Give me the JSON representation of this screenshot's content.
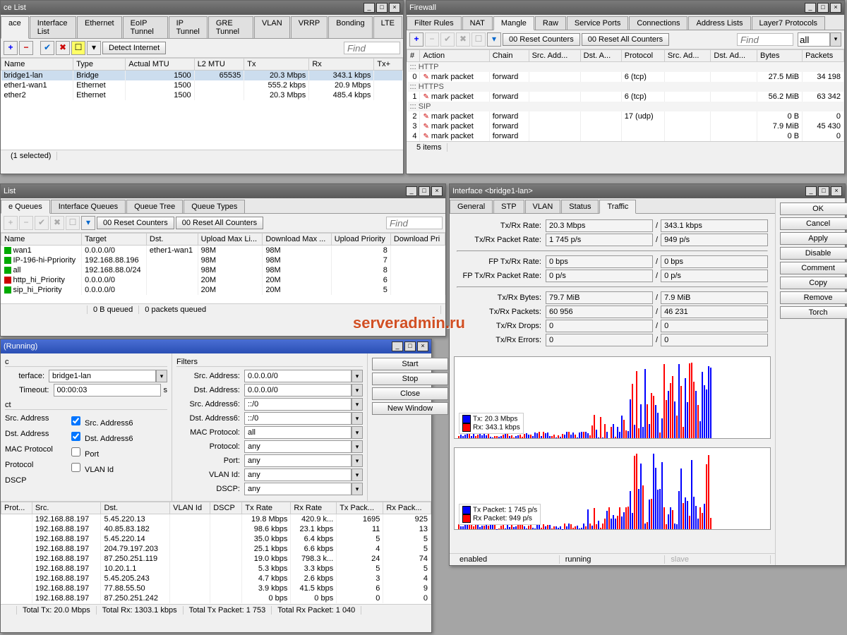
{
  "watermark": "serveradmin.ru",
  "interface_list": {
    "title": "ce List",
    "tabs": [
      "ace",
      "Interface List",
      "Ethernet",
      "EoIP Tunnel",
      "IP Tunnel",
      "GRE Tunnel",
      "VLAN",
      "VRRP",
      "Bonding",
      "LTE"
    ],
    "active_tab": 0,
    "detect_btn": "Detect Internet",
    "find": "Find",
    "cols": [
      "Name",
      "Type",
      "Actual MTU",
      "L2 MTU",
      "Tx",
      "Rx",
      "Tx+"
    ],
    "rows": [
      {
        "name": "bridge1-lan",
        "type": "Bridge",
        "mtu": "1500",
        "l2": "65535",
        "tx": "20.3 Mbps",
        "rx": "343.1 kbps",
        "sel": true
      },
      {
        "name": "ether1-wan1",
        "type": "Ethernet",
        "mtu": "1500",
        "l2": "",
        "tx": "555.2 kbps",
        "rx": "20.9 Mbps"
      },
      {
        "name": "ether2",
        "type": "Ethernet",
        "mtu": "1500",
        "l2": "",
        "tx": "20.3 Mbps",
        "rx": "485.4 kbps"
      }
    ],
    "status": "(1 selected)"
  },
  "firewall": {
    "title": "Firewall",
    "tabs": [
      "Filter Rules",
      "NAT",
      "Mangle",
      "Raw",
      "Service Ports",
      "Connections",
      "Address Lists",
      "Layer7 Protocols"
    ],
    "active_tab": 2,
    "reset": "00 Reset Counters",
    "reset_all": "00 Reset All Counters",
    "find": "Find",
    "all": "all",
    "cols": [
      "#",
      "Action",
      "Chain",
      "Src. Add...",
      "Dst. A...",
      "Protocol",
      "Src. Ad...",
      "Dst. Ad...",
      "Bytes",
      "Packets"
    ],
    "groups": [
      {
        "label": "::: HTTP",
        "rows": [
          {
            "n": "0",
            "act": "mark packet",
            "chain": "forward",
            "proto": "6 (tcp)",
            "bytes": "27.5 MiB",
            "pk": "34 198"
          }
        ]
      },
      {
        "label": "::: HTTPS",
        "rows": [
          {
            "n": "1",
            "act": "mark packet",
            "chain": "forward",
            "proto": "6 (tcp)",
            "bytes": "56.2 MiB",
            "pk": "63 342"
          }
        ]
      },
      {
        "label": "::: SIP",
        "rows": [
          {
            "n": "2",
            "act": "mark packet",
            "chain": "forward",
            "proto": "17 (udp)",
            "bytes": "0 B",
            "pk": "0"
          },
          {
            "n": "3",
            "act": "mark packet",
            "chain": "forward",
            "proto": "",
            "bytes": "7.9 MiB",
            "pk": "45 430"
          },
          {
            "n": "4",
            "act": "mark packet",
            "chain": "forward",
            "proto": "",
            "bytes": "0 B",
            "pk": "0"
          }
        ]
      }
    ],
    "status": "5 items"
  },
  "queue": {
    "title": "List",
    "tabs": [
      "e Queues",
      "Interface Queues",
      "Queue Tree",
      "Queue Types"
    ],
    "active_tab": 0,
    "reset": "00 Reset Counters",
    "reset_all": "00 Reset All Counters",
    "find": "Find",
    "cols": [
      "Name",
      "Target",
      "Dst.",
      "Upload Max Li...",
      "Download Max ...",
      "Upload Priority",
      "Download Pri"
    ],
    "rows": [
      {
        "ic": "g",
        "name": "wan1",
        "target": "0.0.0.0/0",
        "dst": "ether1-wan1",
        "ul": "98M",
        "dl": "98M",
        "up": "8"
      },
      {
        "ic": "g",
        "name": "IP-196-hi-Ppriority",
        "target": "192.168.88.196",
        "dst": "",
        "ul": "98M",
        "dl": "98M",
        "up": "7"
      },
      {
        "ic": "g",
        "name": "all",
        "target": "192.168.88.0/24",
        "dst": "",
        "ul": "98M",
        "dl": "98M",
        "up": "8"
      },
      {
        "ic": "r",
        "name": "http_hi_Priority",
        "target": "0.0.0.0/0",
        "dst": "",
        "ul": "20M",
        "dl": "20M",
        "up": "6"
      },
      {
        "ic": "g",
        "name": "sip_hi_Priority",
        "target": "0.0.0.0/0",
        "dst": "",
        "ul": "20M",
        "dl": "20M",
        "up": "5"
      }
    ],
    "status_b": "0 B queued",
    "status_p": "0 packets queued"
  },
  "torch": {
    "title": "(Running)",
    "basic": "c",
    "filters": "Filters",
    "interface_lbl": "terface:",
    "interface": "bridge1-lan",
    "timeout_lbl": "Timeout:",
    "timeout": "00:00:03",
    "s": "s",
    "section_ct": "ct",
    "opts": [
      "Src. Address",
      "Dst. Address",
      "MAC Protocol",
      "Protocol",
      "DSCP"
    ],
    "chk1": "Src. Address6",
    "chk2": "Dst. Address6",
    "chk3": "Port",
    "chk4": "VLAN Id",
    "f_src": "Src. Address:",
    "f_src_v": "0.0.0.0/0",
    "f_dst": "Dst. Address:",
    "f_dst_v": "0.0.0.0/0",
    "f_src6": "Src. Address6:",
    "f_src6_v": "::/0",
    "f_dst6": "Dst. Address6:",
    "f_dst6_v": "::/0",
    "f_mac": "MAC Protocol:",
    "f_mac_v": "all",
    "f_proto": "Protocol:",
    "f_proto_v": "any",
    "f_port": "Port:",
    "f_port_v": "any",
    "f_vlan": "VLAN Id:",
    "f_vlan_v": "any",
    "f_dscp": "DSCP:",
    "f_dscp_v": "any",
    "btns": [
      "Start",
      "Stop",
      "Close",
      "New Window"
    ],
    "tcols": [
      "Prot...",
      "Src.",
      "Dst.",
      "VLAN Id",
      "DSCP",
      "Tx Rate",
      "Rx Rate",
      "Tx Pack...",
      "Rx Pack..."
    ],
    "trows": [
      {
        "src": "192.168.88.197",
        "dst": "5.45.220.13",
        "tx": "19.8 Mbps",
        "rx": "420.9 k...",
        "txp": "1695",
        "rxp": "925"
      },
      {
        "src": "192.168.88.197",
        "dst": "40.85.83.182",
        "tx": "98.6 kbps",
        "rx": "23.1 kbps",
        "txp": "11",
        "rxp": "13"
      },
      {
        "src": "192.168.88.197",
        "dst": "5.45.220.14",
        "tx": "35.0 kbps",
        "rx": "6.4 kbps",
        "txp": "5",
        "rxp": "5"
      },
      {
        "src": "192.168.88.197",
        "dst": "204.79.197.203",
        "tx": "25.1 kbps",
        "rx": "6.6 kbps",
        "txp": "4",
        "rxp": "5"
      },
      {
        "src": "192.168.88.197",
        "dst": "87.250.251.119",
        "tx": "19.0 kbps",
        "rx": "798.3 k...",
        "txp": "24",
        "rxp": "74"
      },
      {
        "src": "192.168.88.197",
        "dst": "10.20.1.1",
        "tx": "5.3 kbps",
        "rx": "3.3 kbps",
        "txp": "5",
        "rxp": "5"
      },
      {
        "src": "192.168.88.197",
        "dst": "5.45.205.243",
        "tx": "4.7 kbps",
        "rx": "2.6 kbps",
        "txp": "3",
        "rxp": "4"
      },
      {
        "src": "192.168.88.197",
        "dst": "77.88.55.50",
        "tx": "3.9 kbps",
        "rx": "41.5 kbps",
        "txp": "6",
        "rxp": "9"
      },
      {
        "src": "192.168.88.197",
        "dst": "87.250.251.242",
        "tx": "0 bps",
        "rx": "0 bps",
        "txp": "0",
        "rxp": "0"
      }
    ],
    "totals": {
      "tx": "Total Tx: 20.0 Mbps",
      "rx": "Total Rx: 1303.1 kbps",
      "txp": "Total Tx Packet: 1 753",
      "rxp": "Total Rx Packet: 1 040"
    }
  },
  "iface_detail": {
    "title": "Interface <bridge1-lan>",
    "tabs": [
      "General",
      "STP",
      "VLAN",
      "Status",
      "Traffic"
    ],
    "active_tab": 4,
    "rows": [
      {
        "lbl": "Tx/Rx Rate:",
        "a": "20.3 Mbps",
        "b": "343.1 kbps"
      },
      {
        "lbl": "Tx/Rx Packet Rate:",
        "a": "1 745 p/s",
        "b": "949 p/s"
      },
      {
        "lbl": "FP Tx/Rx Rate:",
        "a": "0 bps",
        "b": "0 bps"
      },
      {
        "lbl": "FP Tx/Rx Packet Rate:",
        "a": "0 p/s",
        "b": "0 p/s"
      },
      {
        "lbl": "Tx/Rx Bytes:",
        "a": "79.7 MiB",
        "b": "7.9 MiB"
      },
      {
        "lbl": "Tx/Rx Packets:",
        "a": "60 956",
        "b": "46 231"
      },
      {
        "lbl": "Tx/Rx Drops:",
        "a": "0",
        "b": "0"
      },
      {
        "lbl": "Tx/Rx Errors:",
        "a": "0",
        "b": "0"
      }
    ],
    "legend1": {
      "tx": "Tx: 20.3 Mbps",
      "rx": "Rx: 343.1 kbps"
    },
    "legend2": {
      "tx": "Tx Packet: 1 745 p/s",
      "rx": "Rx Packet: 949 p/s"
    },
    "btns": [
      "OK",
      "Cancel",
      "Apply",
      "Disable",
      "Comment",
      "Copy",
      "Remove",
      "Torch"
    ],
    "status": {
      "en": "enabled",
      "run": "running",
      "slave": "slave"
    }
  },
  "chart_data": [
    {
      "type": "bar",
      "title": "Tx/Rx Rate",
      "series": [
        {
          "name": "Tx",
          "color": "#0000ff"
        },
        {
          "name": "Rx",
          "color": "#ff0000"
        }
      ],
      "note": "realtime sparkline, values match legend1"
    },
    {
      "type": "bar",
      "title": "Tx/Rx Packet Rate",
      "series": [
        {
          "name": "Tx Packet",
          "color": "#0000ff"
        },
        {
          "name": "Rx Packet",
          "color": "#ff0000"
        }
      ],
      "note": "realtime sparkline, values match legend2"
    }
  ]
}
